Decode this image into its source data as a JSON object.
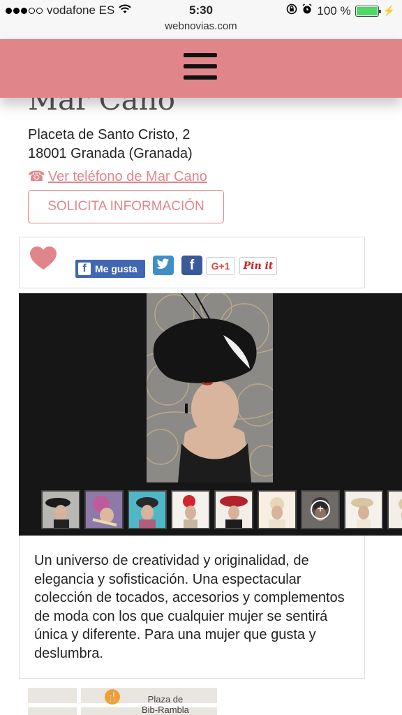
{
  "status_bar": {
    "carrier": "vodafone ES",
    "time": "5:30",
    "url": "webnovias.com",
    "battery": "100 %"
  },
  "vendor": {
    "name": "Mar Cano",
    "address_line1": "Placeta de Santo Cristo, 2",
    "address_line2": "18001 Granada (Granada)",
    "phone_link": "Ver teléfono de Mar Cano",
    "info_button": "SOLICITA INFORMACIÓN"
  },
  "social": {
    "fb_like": "Me gusta",
    "gplus": "G+1",
    "pinit": "Pin it"
  },
  "description": "Un universo de creatividad y originalidad, de elegancia y sofisticación. Una espectacular colección de tocados, accesorios y complementos de moda con los que cualquier mujer se sentirá única y diferente. Para una mujer que gusta y deslumbra.",
  "map": {
    "label_line1": "Plaza de",
    "label_line2": "Bib-Rambla"
  },
  "colors": {
    "brand_pink": "#e0868b",
    "facebook": "#4267b2",
    "twitter": "#3f8fc6",
    "battery_green": "#4cd964"
  },
  "icons": {
    "menu": "hamburger-icon",
    "phone": "phone-icon",
    "favorite": "heart-icon",
    "map_poi": "restaurant-icon"
  }
}
